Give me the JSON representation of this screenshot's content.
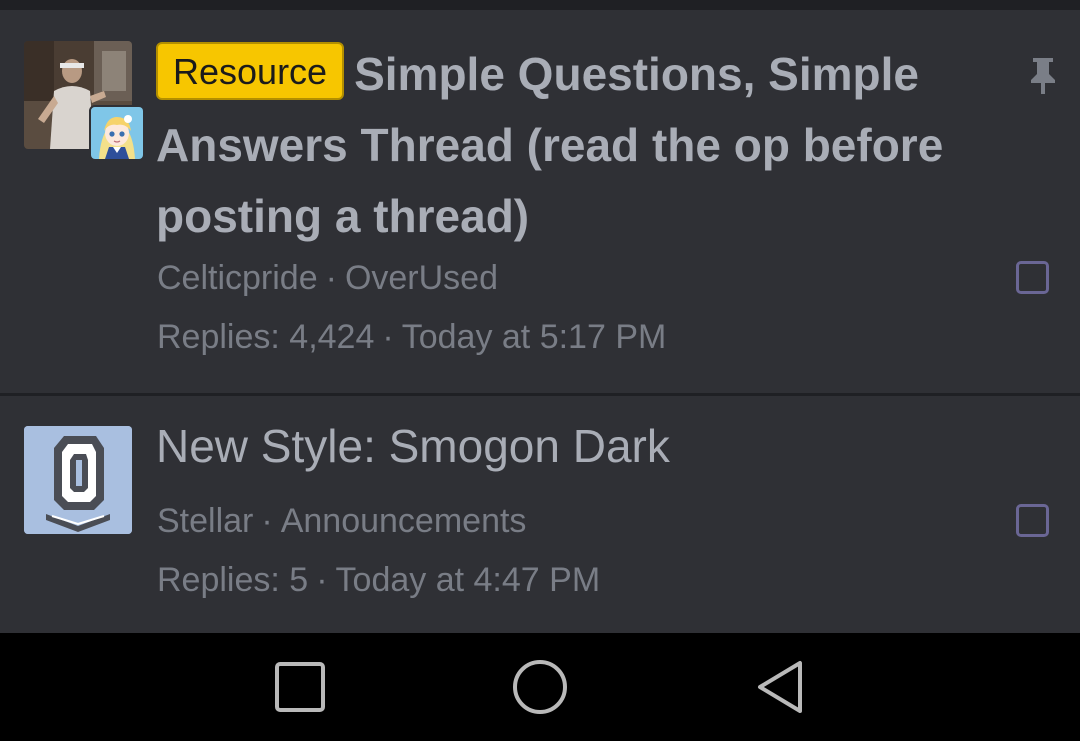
{
  "threads": [
    {
      "prefix": "Resource",
      "title": "Simple Questions, Simple Answers Thread (read the op before posting a thread)",
      "author": "Celticpride",
      "forum": "OverUsed",
      "replies_label": "Replies:",
      "replies": "4,424",
      "last_post": "Today at 5:17 PM",
      "pinned": true,
      "avatar_icon": "user-photo-avatar",
      "secondary_avatar_icon": "anime-girl-avatar"
    },
    {
      "prefix": "",
      "title": "New Style: Smogon Dark",
      "author": "Stellar",
      "forum": "Announcements",
      "replies_label": "Replies:",
      "replies": "5",
      "last_post": "Today at 4:47 PM",
      "pinned": false,
      "avatar_icon": "smogon-logo-avatar"
    }
  ],
  "separator": "·",
  "nav": {
    "recent_icon": "square-icon",
    "home_icon": "circle-icon",
    "back_icon": "triangle-back-icon"
  },
  "colors": {
    "background": "#2f3035",
    "prefix_badge": "#f7c600",
    "title_text": "#a9adb6",
    "meta_text": "#797d86",
    "checkbox": "#6a6695"
  }
}
